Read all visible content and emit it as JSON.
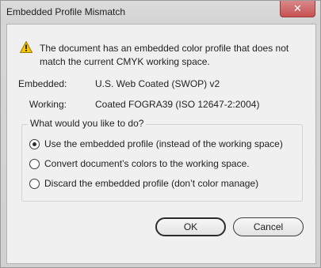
{
  "window": {
    "title": "Embedded Profile Mismatch",
    "close_glyph": "✕"
  },
  "dialog": {
    "message": "The document has an embedded color profile that does not match the current CMYK working space.",
    "icon": "warning-icon",
    "profiles": [
      {
        "label": "Embedded:",
        "value": "U.S. Web Coated (SWOP) v2"
      },
      {
        "label": "Working:",
        "value": "Coated FOGRA39 (ISO 12647-2:2004)"
      }
    ],
    "options_title": "What would you like to do?",
    "options": [
      {
        "label": "Use the embedded profile (instead of the working space)",
        "selected": true
      },
      {
        "label": "Convert document’s colors to the working space.",
        "selected": false
      },
      {
        "label": "Discard the embedded profile (don’t color manage)",
        "selected": false
      }
    ],
    "ok_label": "OK",
    "cancel_label": "Cancel"
  },
  "colors": {
    "warning": "#f2c500",
    "close": "#c75050"
  }
}
